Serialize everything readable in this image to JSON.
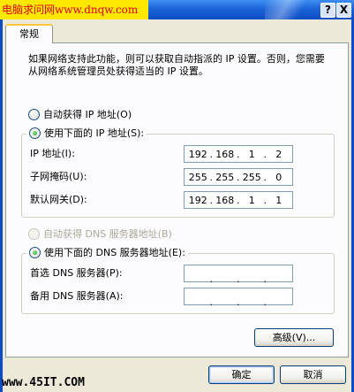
{
  "window": {
    "site_banner": "电脑求问网www.dnqw.com",
    "help_label": "?",
    "close_label": "X"
  },
  "tabs": [
    {
      "label": "常规"
    }
  ],
  "description": "如果网络支持此功能，则可以获取自动指派的 IP 设置。否则，您需要从网络系统管理员处获得适当的 IP 设置。",
  "ip_mode": {
    "auto_label": "自动获得 IP 地址(O)",
    "manual_label": "使用下面的 IP 地址(S):",
    "selected": "manual"
  },
  "ip_fields": [
    {
      "label": "IP 地址(I):",
      "octets": [
        "192",
        "168",
        "1",
        "2"
      ]
    },
    {
      "label": "子网掩码(U):",
      "octets": [
        "255",
        "255",
        "255",
        "0"
      ]
    },
    {
      "label": "默认网关(D):",
      "octets": [
        "192",
        "168",
        "1",
        "1"
      ]
    }
  ],
  "dns_mode": {
    "auto_label": "自动获得 DNS 服务器地址(B)",
    "manual_label": "使用下面的 DNS 服务器地址(E):",
    "selected": "manual"
  },
  "dns_fields": [
    {
      "label": "首选 DNS 服务器(P):",
      "octets": [
        "",
        "",
        "",
        ""
      ]
    },
    {
      "label": "备用 DNS 服务器(A):",
      "octets": [
        "",
        "",
        "",
        ""
      ]
    }
  ],
  "buttons": {
    "advanced": "高级(V)...",
    "ok": "确定",
    "cancel": "取消"
  },
  "watermark": "www.45IT.COM"
}
